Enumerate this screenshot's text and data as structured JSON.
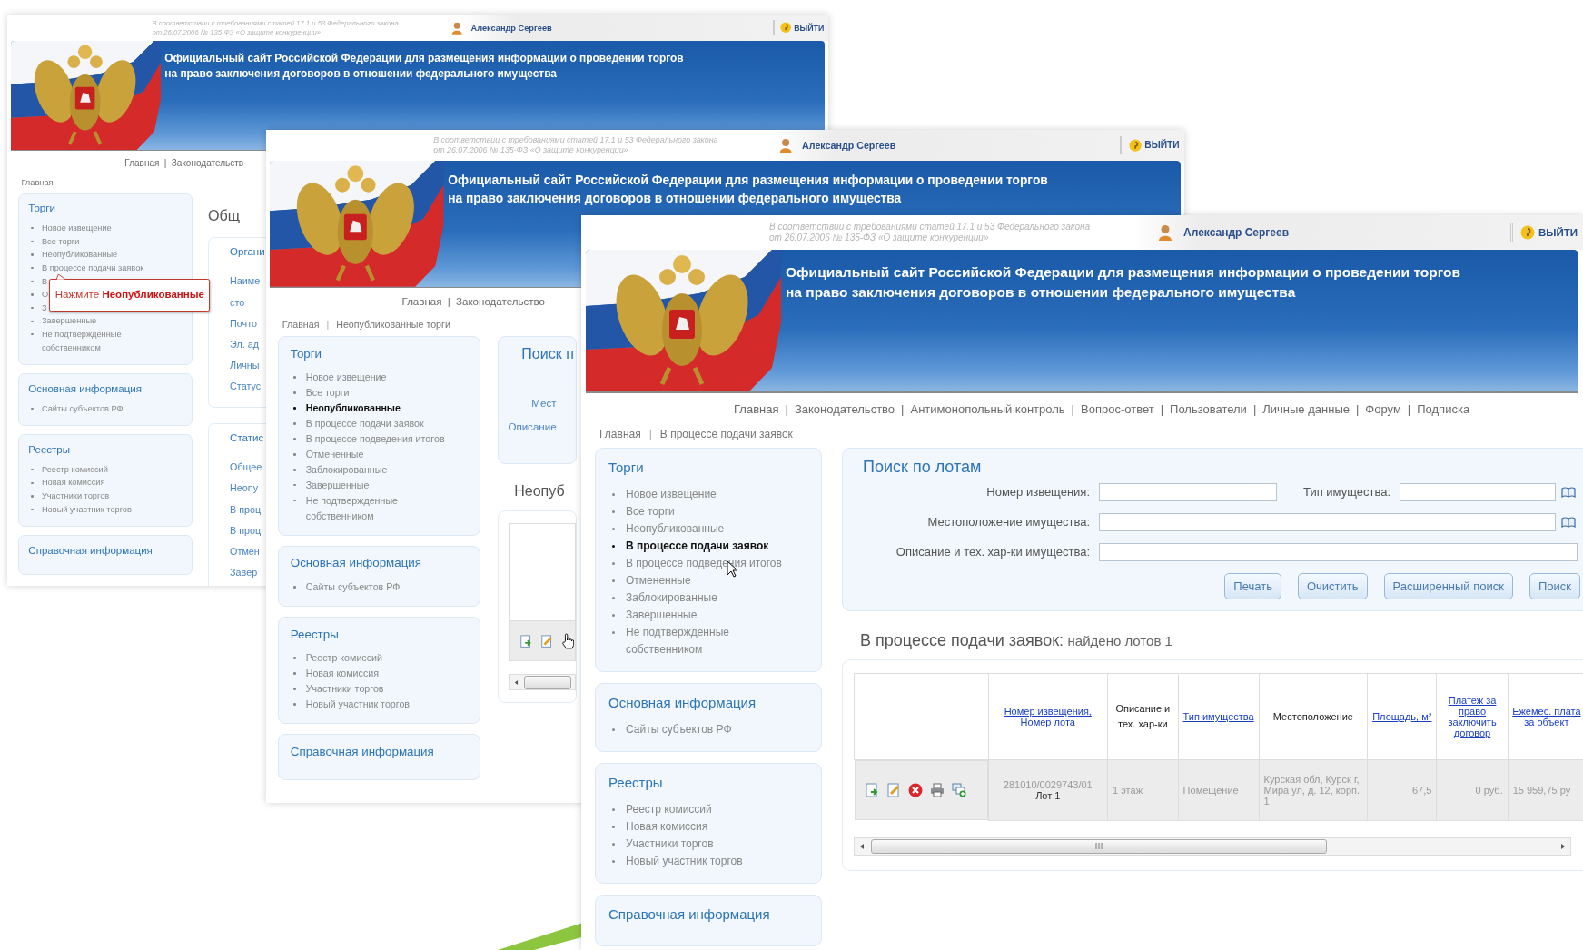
{
  "windows": [
    {
      "legal_note": [
        "В соответствии с требованиями статей 17.1 и 53 Федерального закона",
        "от 26.07.2006 № 135-ФЗ «О защите конкуренции»"
      ],
      "user_name": "Александр Сергеев",
      "logout": "ВЫЙТИ",
      "banner_title": [
        "Официальный сайт Российской Федерации для размещения информации о проведении торгов",
        "на право заключения договоров в отношении федерального имущества"
      ],
      "nav": {
        "separator": "|",
        "items": [
          "Главная",
          "Законодательств"
        ]
      },
      "breadcrumb": {
        "items": [
          "Главная"
        ]
      },
      "sidebar": [
        {
          "title": "Торги",
          "items": [
            {
              "label": "Новое извещение",
              "selected": false
            },
            {
              "label": "Все торги",
              "selected": false
            },
            {
              "label": "Неопубликованные",
              "selected": false
            },
            {
              "label": "В процессе подачи заявок",
              "selected": false,
              "callout": "Нажмите **Неопубликованные**"
            },
            {
              "label": "В",
              "selected": false
            },
            {
              "label": "О",
              "selected": false
            },
            {
              "label": "З",
              "selected": false
            },
            {
              "label": "Завершенные",
              "selected": false
            },
            {
              "label": "Не подтвержденные собственником",
              "selected": false
            }
          ]
        },
        {
          "title": "Основная информация",
          "items": [
            {
              "label": "Сайты субъектов РФ",
              "selected": false
            }
          ]
        },
        {
          "title": "Реестры",
          "items": [
            {
              "label": "Реестр комиссий",
              "selected": false
            },
            {
              "label": "Новая комиссия",
              "selected": false
            },
            {
              "label": "Участники торгов",
              "selected": false
            },
            {
              "label": "Новый участник торгов",
              "selected": false
            }
          ]
        },
        {
          "title": "Справочная информация"
        }
      ],
      "main": {
        "kind": "overview",
        "heading": "Общ",
        "panels": [
          {
            "title": "Органи",
            "rows": [
              "Наиме",
              "сто",
              "Почто",
              "Эл. ад",
              "Личны",
              "Статус"
            ]
          },
          {
            "title": "Статис",
            "rows": [
              "Общее",
              "Неопу",
              "В проц",
              "В проц",
              "Отмен",
              "Завер"
            ]
          }
        ]
      }
    },
    {
      "legal_note": [
        "В соответствии с требованиями статей 17.1 и 53 Федерального закона",
        "от 26.07.2006 № 135-ФЗ «О защите конкуренции»"
      ],
      "user_name": "Александр Сергеев",
      "logout": "ВЫЙТИ",
      "banner_title": [
        "Официальный сайт Российской Федерации для размещения информации о проведении торгов",
        "на право заключения договоров в отношении федерального имущества"
      ],
      "nav": {
        "separator": "|",
        "items": [
          "Главная",
          "Законодательство"
        ]
      },
      "breadcrumb": {
        "separator": "|",
        "items": [
          "Главная",
          "Неопубликованные торги"
        ]
      },
      "sidebar": [
        {
          "title": "Торги",
          "items": [
            {
              "label": "Новое извещение",
              "selected": false
            },
            {
              "label": "Все торги",
              "selected": false
            },
            {
              "label": "Неопубликованные",
              "selected": true
            },
            {
              "label": "В процессе подачи заявок",
              "selected": false
            },
            {
              "label": "В процессе подведения итогов",
              "selected": false
            },
            {
              "label": "Отмененные",
              "selected": false
            },
            {
              "label": "Заблокированные",
              "selected": false
            },
            {
              "label": "Завершенные",
              "selected": false
            },
            {
              "label": "Не подтвержденные собственником",
              "selected": false
            }
          ]
        },
        {
          "title": "Основная информация",
          "items": [
            {
              "label": "Сайты субъектов РФ",
              "selected": false
            }
          ]
        },
        {
          "title": "Реестры",
          "items": [
            {
              "label": "Реестр комиссий",
              "selected": false
            },
            {
              "label": "Новая комиссия",
              "selected": false
            },
            {
              "label": "Участники торгов",
              "selected": false
            },
            {
              "label": "Новый участник торгов",
              "selected": false
            }
          ]
        },
        {
          "title": "Справочная информация"
        }
      ],
      "main": {
        "kind": "search_partial",
        "search_title": "Поиск п",
        "labels": [
          "Мест",
          "Описание"
        ],
        "results_title": "Неопуб"
      }
    },
    {
      "legal_note": [
        "В соответствии с требованиями статей 17.1 и 53 Федерального закона",
        "от 26.07.2006 № 135-ФЗ «О защите конкуренции»"
      ],
      "user_name": "Александр Сергеев",
      "logout": "ВЫЙТИ",
      "banner_title": [
        "Официальный сайт Российской Федерации для размещения информации о проведении торгов",
        "на право заключения договоров в отношении федерального имущества"
      ],
      "nav": {
        "separator": "|",
        "items": [
          "Главная",
          "Законодательство",
          "Антимонопольный контроль",
          "Вопрос-ответ",
          "Пользователи",
          "Личные данные",
          "Форум",
          "Подписка"
        ]
      },
      "breadcrumb": {
        "separator": "|",
        "items": [
          "Главная",
          "В процессе подачи заявок"
        ]
      },
      "sidebar": [
        {
          "title": "Торги",
          "items": [
            {
              "label": "Новое извещение",
              "selected": false
            },
            {
              "label": "Все торги",
              "selected": false
            },
            {
              "label": "Неопубликованные",
              "selected": false
            },
            {
              "label": "В процессе подачи заявок",
              "selected": true
            },
            {
              "label": "В процессе подведения итогов",
              "selected": false
            },
            {
              "label": "Отмененные",
              "selected": false
            },
            {
              "label": "Заблокированные",
              "selected": false
            },
            {
              "label": "Завершенные",
              "selected": false
            },
            {
              "label": "Не подтвержденные собственником",
              "selected": false
            }
          ]
        },
        {
          "title": "Основная информация",
          "items": [
            {
              "label": "Сайты субъектов РФ",
              "selected": false
            }
          ]
        },
        {
          "title": "Реестры",
          "items": [
            {
              "label": "Реестр комиссий",
              "selected": false
            },
            {
              "label": "Новая комиссия",
              "selected": false
            },
            {
              "label": "Участники торгов",
              "selected": false
            },
            {
              "label": "Новый участник торгов",
              "selected": false
            }
          ]
        },
        {
          "title": "Справочная информация"
        }
      ],
      "main": {
        "kind": "search",
        "search_title": "Поиск по лотам",
        "search_rows": [
          [
            {
              "label": "Номер извещения:",
              "picker": false
            },
            {
              "label": "Тип имущества:",
              "picker": true
            }
          ],
          [
            {
              "label": "Местоположение имущества:",
              "picker": true
            }
          ],
          [
            {
              "label": "Описание и тех. хар-ки имущества:",
              "picker": false
            }
          ]
        ],
        "buttons": [
          "Печать",
          "Очистить",
          "Расширенный поиск",
          "Поиск"
        ],
        "results_title": "В процессе подачи заявок:",
        "results_count": "найдено лотов 1",
        "table": {
          "columns": [
            {
              "label": "Номер извещения, Номер лота",
              "link": true
            },
            {
              "label": "Описание и тех. хар-ки",
              "link": false
            },
            {
              "label": "Тип имущества",
              "link": true
            },
            {
              "label": "Местоположение",
              "link": false
            },
            {
              "label": "Площадь, м²",
              "link": true
            },
            {
              "label": "Платеж за право заключить договор",
              "link": true
            },
            {
              "label": "Ежемес. плата за объект",
              "link": true
            }
          ],
          "rows": [
            {
              "lot": "Лот 1",
              "cells": [
                "281010/0029743/01",
                "1 этаж",
                "Помещение",
                "Курская обл, Курск г, Мира ул, д. 12, корп. 1",
                "67,5",
                "0 руб.",
                "15 959,75 ру"
              ]
            }
          ]
        }
      }
    }
  ]
}
